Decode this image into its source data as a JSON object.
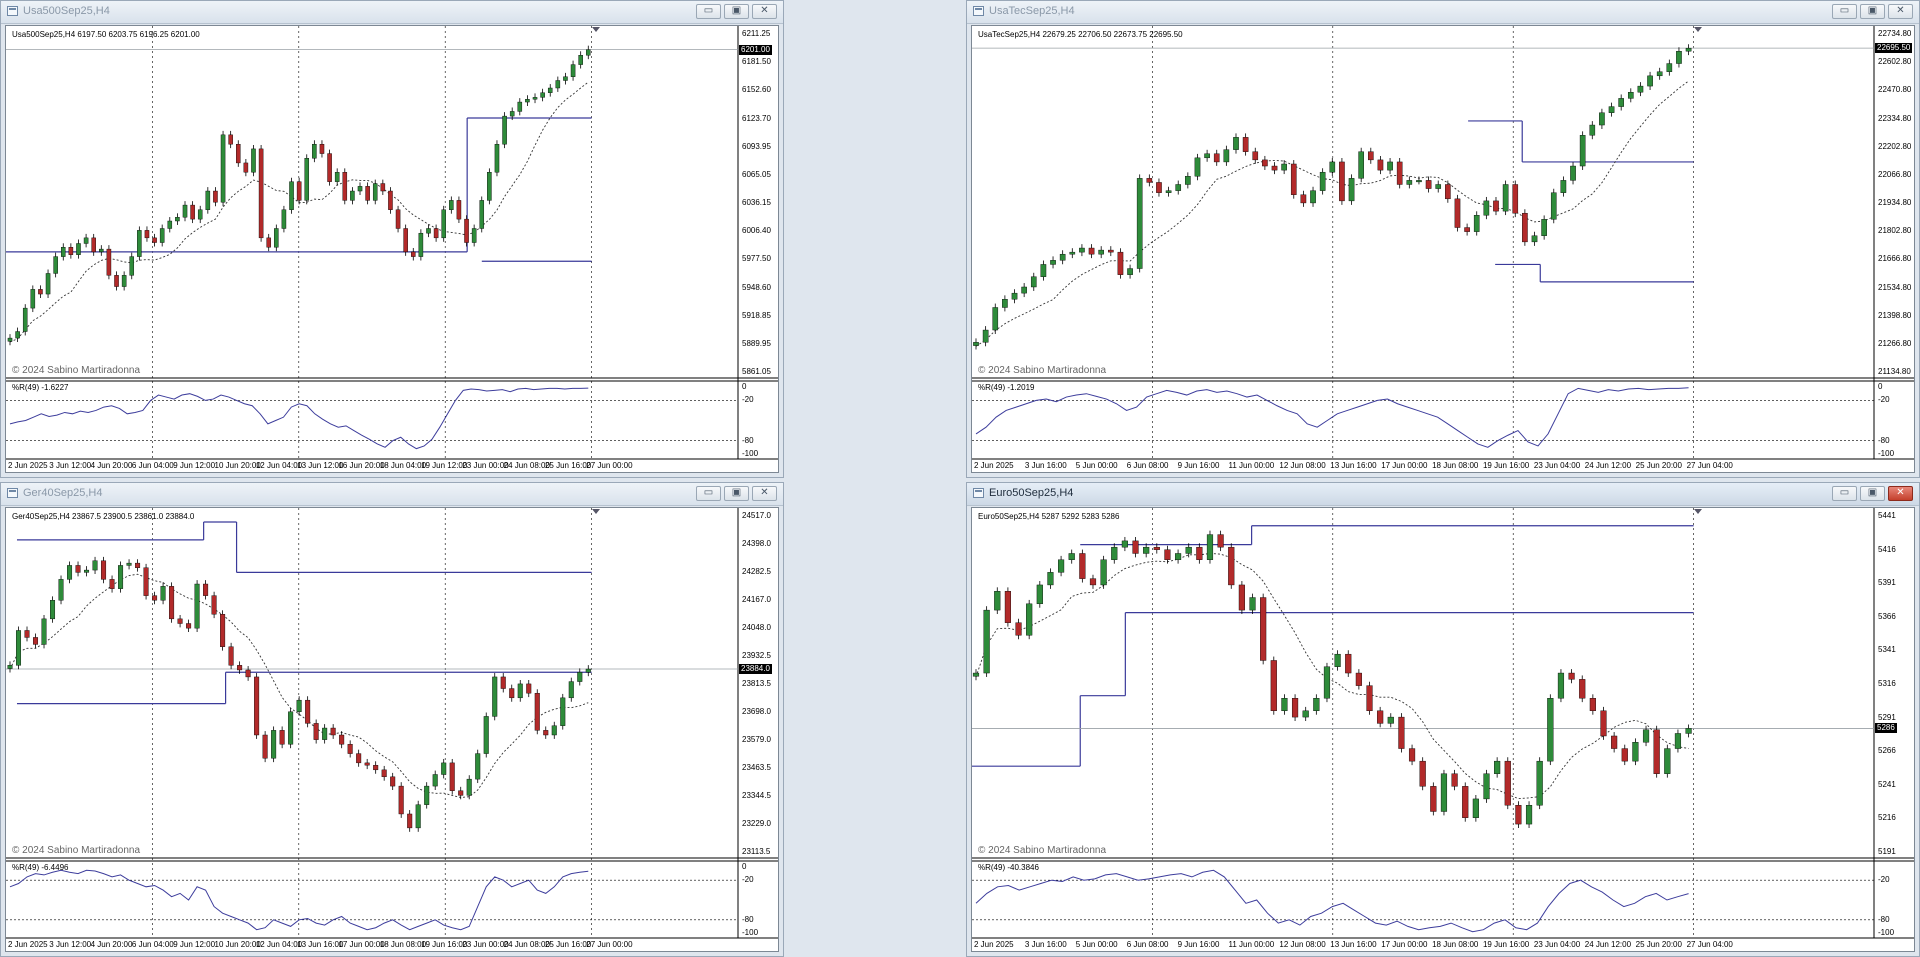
{
  "windows": [
    {
      "id": "usa500",
      "title": "Usa500Sep25,H4",
      "active": false,
      "header": "Usa500Sep25,H4  6197.50 6203.75 6196.25 6201.00",
      "copyright": "© 2024 Sabino Martiradonna",
      "indicator_label": "%R(49) -1.6227",
      "current_price": "6201.00",
      "price_ticks": [
        "6211.25",
        "6181.50",
        "6152.60",
        "6123.70",
        "6093.95",
        "6065.05",
        "6036.15",
        "6006.40",
        "5977.50",
        "5948.60",
        "5918.85",
        "5889.95",
        "5861.05"
      ],
      "ind_ticks": [
        "0",
        "-20",
        "-80",
        "-100"
      ],
      "time_ticks": [
        "2 Jun 2025",
        "3 Jun 12:00",
        "4 Jun 20:00",
        "6 Jun 04:00",
        "9 Jun 12:00",
        "10 Jun 20:00",
        "12 Jun 04:00",
        "13 Jun 12:00",
        "16 Jun 20:00",
        "18 Jun 04:00",
        "19 Jun 12:00",
        "23 Jun 00:00",
        "24 Jun 08:00",
        "25 Jun 16:00",
        "27 Jun 00:00"
      ],
      "ohlc_path": [
        5893,
        5900,
        5925,
        5945,
        5940,
        5962,
        5980,
        5990,
        5982,
        5994,
        6000,
        5985,
        5988,
        5960,
        5948,
        5960,
        5980,
        6008,
        6000,
        5995,
        6010,
        6018,
        6022,
        6035,
        6020,
        6030,
        6050,
        6038,
        6110,
        6100,
        6080,
        6070,
        6095,
        6000,
        5990,
        6010,
        6030,
        6060,
        6040,
        6085,
        6100,
        6090,
        6060,
        6070,
        6040,
        6050,
        6055,
        6040,
        6058,
        6050,
        6030,
        6010,
        5985,
        5980,
        6005,
        6010,
        6000,
        6030,
        6040,
        6020,
        5995,
        6010,
        6040,
        6070,
        6100,
        6130,
        6135,
        6145,
        6148,
        6150,
        6155,
        6160,
        6168,
        6172,
        6185,
        6195,
        6201
      ],
      "range": [
        5861.05,
        6211.25
      ],
      "levels": [
        {
          "from": 0,
          "to": 0.63,
          "price": 5985.0
        },
        {
          "from": 0.63,
          "to": 0.8,
          "price": 6128.0
        },
        {
          "from": 0.65,
          "to": 0.8,
          "price": 5975.0
        }
      ],
      "wr_values": [
        -55,
        -52,
        -50,
        -45,
        -40,
        -44,
        -42,
        -38,
        -40,
        -36,
        -38,
        -35,
        -30,
        -28,
        -32,
        -40,
        -38,
        -35,
        -20,
        -12,
        -15,
        -18,
        -12,
        -10,
        -14,
        -20,
        -18,
        -12,
        -15,
        -20,
        -25,
        -28,
        -40,
        -55,
        -50,
        -45,
        -30,
        -25,
        -28,
        -40,
        -48,
        -55,
        -60,
        -58,
        -65,
        -72,
        -78,
        -85,
        -90,
        -80,
        -75,
        -85,
        -92,
        -88,
        -78,
        -60,
        -40,
        -20,
        -5,
        -3,
        -4,
        -6,
        -5,
        -4,
        -7,
        -3,
        -2,
        -4,
        -3,
        -2,
        -2,
        -3,
        -2,
        -2,
        -1.6
      ]
    },
    {
      "id": "usatec",
      "title": "UsaTecSep25,H4",
      "active": false,
      "header": "UsaTecSep25,H4  22679.25 22706.50 22673.75 22695.50",
      "copyright": "© 2024 Sabino Martiradonna",
      "indicator_label": "%R(49) -1.2019",
      "current_price": "22695.50",
      "price_ticks": [
        "22734.80",
        "22602.80",
        "22470.80",
        "22334.80",
        "22202.80",
        "22066.80",
        "21934.80",
        "21802.80",
        "21666.80",
        "21534.80",
        "21398.80",
        "21266.80",
        "21134.80"
      ],
      "ind_ticks": [
        "0",
        "-20",
        "-80",
        "-100"
      ],
      "time_ticks": [
        "2 Jun 2025",
        "3 Jun 16:00",
        "5 Jun 00:00",
        "6 Jun 08:00",
        "9 Jun 16:00",
        "11 Jun 00:00",
        "12 Jun 08:00",
        "13 Jun 16:00",
        "17 Jun 00:00",
        "18 Jun 08:00",
        "19 Jun 16:00",
        "23 Jun 04:00",
        "24 Jun 12:00",
        "25 Jun 20:00",
        "27 Jun 04:00"
      ],
      "ohlc_path": [
        21260,
        21320,
        21430,
        21470,
        21500,
        21530,
        21580,
        21640,
        21660,
        21690,
        21700,
        21720,
        21690,
        21710,
        21700,
        21590,
        21620,
        22060,
        22040,
        21990,
        22000,
        22030,
        22070,
        22160,
        22180,
        22140,
        22200,
        22260,
        22190,
        22150,
        22120,
        22100,
        22130,
        21980,
        21940,
        22000,
        22090,
        22140,
        21950,
        22060,
        22190,
        22150,
        22100,
        22140,
        22030,
        22050,
        22050,
        22010,
        22030,
        21960,
        21820,
        21800,
        21880,
        21950,
        21900,
        22030,
        21890,
        21750,
        21780,
        21860,
        21990,
        22050,
        22120,
        22270,
        22320,
        22380,
        22410,
        22450,
        22480,
        22510,
        22560,
        22580,
        22620,
        22680,
        22695
      ],
      "range": [
        21134.8,
        22734.8
      ],
      "levels": [
        {
          "from": 0.55,
          "to": 0.61,
          "price": 22340.0
        },
        {
          "from": 0.61,
          "to": 0.8,
          "price": 22140.0
        },
        {
          "from": 0.58,
          "to": 0.63,
          "price": 21640.0
        },
        {
          "from": 0.63,
          "to": 0.8,
          "price": 21555.0
        }
      ],
      "wr_values": [
        -70,
        -60,
        -45,
        -35,
        -30,
        -25,
        -20,
        -18,
        -22,
        -15,
        -12,
        -10,
        -14,
        -18,
        -25,
        -35,
        -30,
        -15,
        -10,
        -5,
        -8,
        -12,
        -6,
        -4,
        -8,
        -6,
        -10,
        -15,
        -12,
        -20,
        -28,
        -35,
        -40,
        -55,
        -60,
        -50,
        -40,
        -35,
        -30,
        -25,
        -20,
        -18,
        -25,
        -30,
        -35,
        -40,
        -45,
        -55,
        -65,
        -75,
        -85,
        -90,
        -80,
        -72,
        -65,
        -82,
        -88,
        -70,
        -40,
        -10,
        -2,
        -5,
        -8,
        -4,
        -6,
        -3,
        -2,
        -4,
        -3,
        -2,
        -2,
        -1.2
      ]
    },
    {
      "id": "ger40",
      "title": "Ger40Sep25,H4",
      "active": false,
      "header": "Ger40Sep25,H4  23867.5 23900.5 23861.0 23884.0",
      "copyright": "© 2024 Sabino Martiradonna",
      "indicator_label": "%R(49) -6.4496",
      "current_price": "23884.0",
      "price_ticks": [
        "24517.0",
        "24398.0",
        "24282.5",
        "24167.0",
        "24048.0",
        "23932.5",
        "23813.5",
        "23698.0",
        "23579.0",
        "23463.5",
        "23344.5",
        "23229.0",
        "23113.5"
      ],
      "ind_ticks": [
        "0",
        "-20",
        "-80",
        "-100"
      ],
      "time_ticks": [
        "2 Jun 2025",
        "3 Jun 12:00",
        "4 Jun 20:00",
        "6 Jun 04:00",
        "9 Jun 12:00",
        "10 Jun 20:00",
        "12 Jun 04:00",
        "13 Jun 16:00",
        "17 Jun 00:00",
        "18 Jun 08:00",
        "19 Jun 16:00",
        "23 Jun 00:00",
        "24 Jun 08:00",
        "25 Jun 16:00",
        "27 Jun 00:00"
      ],
      "ohlc_path": [
        23900,
        24050,
        24020,
        23990,
        24100,
        24180,
        24270,
        24330,
        24300,
        24310,
        24350,
        24270,
        24230,
        24330,
        24340,
        24320,
        24200,
        24180,
        24240,
        24100,
        24080,
        24060,
        24250,
        24200,
        24120,
        23980,
        23900,
        23880,
        23850,
        23600,
        23500,
        23620,
        23560,
        23700,
        23750,
        23650,
        23580,
        23630,
        23600,
        23560,
        23520,
        23480,
        23470,
        23450,
        23420,
        23380,
        23260,
        23200,
        23300,
        23380,
        23430,
        23480,
        23360,
        23340,
        23410,
        23520,
        23680,
        23850,
        23800,
        23760,
        23820,
        23780,
        23620,
        23600,
        23640,
        23760,
        23830,
        23870,
        23884
      ],
      "range": [
        23113.5,
        24517.0
      ],
      "levels": [
        {
          "from": 0.015,
          "to": 0.27,
          "price": 24440.0
        },
        {
          "from": 0.27,
          "to": 0.315,
          "price": 24517.0
        },
        {
          "from": 0.315,
          "to": 0.8,
          "price": 24300.0
        },
        {
          "from": 0.015,
          "to": 0.3,
          "price": 23735.0
        },
        {
          "from": 0.3,
          "to": 0.8,
          "price": 23870.0
        }
      ],
      "wr_values": [
        -30,
        -25,
        -15,
        -10,
        -12,
        -8,
        -5,
        -8,
        -10,
        -5,
        -6,
        -10,
        -15,
        -12,
        -20,
        -25,
        -30,
        -28,
        -35,
        -45,
        -40,
        -50,
        -30,
        -35,
        -60,
        -70,
        -75,
        -80,
        -85,
        -95,
        -92,
        -80,
        -85,
        -90,
        -80,
        -78,
        -85,
        -88,
        -80,
        -75,
        -85,
        -90,
        -95,
        -92,
        -85,
        -80,
        -88,
        -95,
        -90,
        -85,
        -80,
        -88,
        -92,
        -95,
        -90,
        -60,
        -30,
        -15,
        -20,
        -30,
        -25,
        -20,
        -35,
        -40,
        -30,
        -15,
        -10,
        -8,
        -6.4
      ]
    },
    {
      "id": "euro50",
      "title": "Euro50Sep25,H4",
      "active": true,
      "header": "Euro50Sep25,H4  5287 5292 5283 5286",
      "copyright": "© 2024 Sabino Martiradonna",
      "indicator_label": "%R(49) -40.3846",
      "current_price": "5286",
      "price_ticks": [
        "5441",
        "5416",
        "5391",
        "5366",
        "5341",
        "5316",
        "5291",
        "5266",
        "5241",
        "5216",
        "5191"
      ],
      "ind_ticks": [
        "-20",
        "-80",
        "-100"
      ],
      "time_ticks": [
        "2 Jun 2025",
        "3 Jun 16:00",
        "5 Jun 00:00",
        "6 Jun 08:00",
        "9 Jun 16:00",
        "11 Jun 00:00",
        "12 Jun 08:00",
        "13 Jun 16:00",
        "17 Jun 00:00",
        "18 Jun 08:00",
        "19 Jun 16:00",
        "23 Jun 04:00",
        "24 Jun 12:00",
        "25 Jun 20:00",
        "27 Jun 04:00"
      ],
      "ohlc_path": [
        5330,
        5380,
        5395,
        5370,
        5360,
        5385,
        5400,
        5410,
        5420,
        5425,
        5405,
        5400,
        5420,
        5430,
        5435,
        5425,
        5430,
        5428,
        5420,
        5425,
        5430,
        5420,
        5440,
        5430,
        5400,
        5380,
        5390,
        5340,
        5300,
        5310,
        5295,
        5300,
        5310,
        5335,
        5345,
        5330,
        5320,
        5300,
        5290,
        5295,
        5270,
        5260,
        5240,
        5220,
        5250,
        5240,
        5215,
        5230,
        5250,
        5260,
        5225,
        5210,
        5225,
        5260,
        5310,
        5330,
        5325,
        5310,
        5300,
        5280,
        5270,
        5260,
        5275,
        5285,
        5250,
        5270,
        5282,
        5286
      ],
      "range": [
        5191,
        5450
      ],
      "levels": [
        {
          "from": 0,
          "to": 0.12,
          "price": 5256.0
        },
        {
          "from": 0.12,
          "to": 0.17,
          "price": 5312.0
        },
        {
          "from": 0.17,
          "to": 0.8,
          "price": 5378.0
        },
        {
          "from": 0.12,
          "to": 0.31,
          "price": 5432.0
        },
        {
          "from": 0.31,
          "to": 0.8,
          "price": 5447.0
        }
      ],
      "wr_values": [
        -55,
        -40,
        -30,
        -28,
        -35,
        -30,
        -25,
        -20,
        -22,
        -15,
        -20,
        -18,
        -12,
        -10,
        -15,
        -20,
        -18,
        -15,
        -12,
        -10,
        -15,
        -8,
        -5,
        -15,
        -35,
        -55,
        -50,
        -70,
        -85,
        -80,
        -88,
        -75,
        -70,
        -60,
        -55,
        -65,
        -75,
        -85,
        -88,
        -82,
        -90,
        -95,
        -92,
        -90,
        -85,
        -92,
        -98,
        -95,
        -85,
        -80,
        -92,
        -95,
        -85,
        -60,
        -40,
        -25,
        -20,
        -30,
        -38,
        -50,
        -60,
        -55,
        -45,
        -40,
        -50,
        -45,
        -40.4
      ]
    }
  ],
  "colors": {
    "bull": "#2e8b3a",
    "bear": "#b22a2a",
    "level": "#3a3a9a",
    "ma": "#333333",
    "grid": "#000000",
    "wr": "#3d3d9c"
  }
}
